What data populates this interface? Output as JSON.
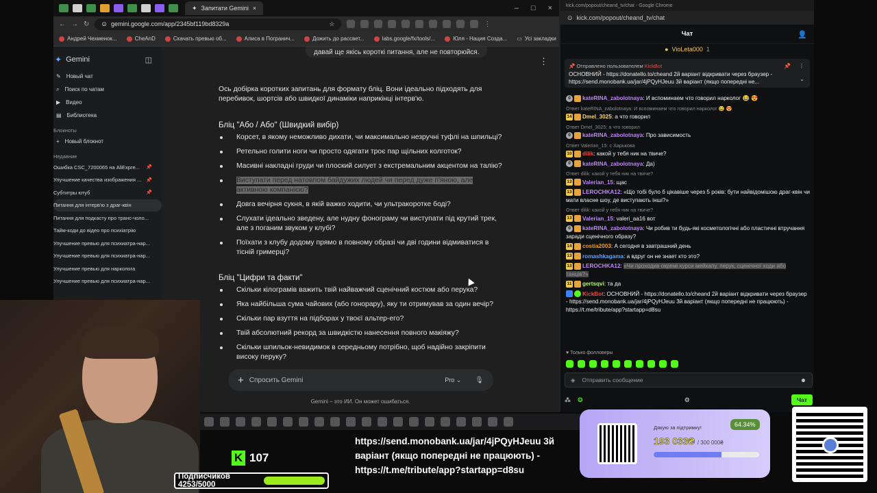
{
  "browser": {
    "active_tab": "Запитати Gemini",
    "url": "gemini.google.com/app/2345bf119bd8329a",
    "bookmarks": [
      "Андрей Чехменок...",
      "CheAnD",
      "Скачать превью об...",
      "Алиса в Погранич...",
      "Дожить до рассвет...",
      "labs.google/fx/tools/...",
      "Юля - Нация Созда...",
      "Усі закладки"
    ]
  },
  "gemini": {
    "logo": "Gemini",
    "nav": [
      "Новый чат",
      "Поиск по чатам",
      "Видео",
      "Библиотека"
    ],
    "notebooks_label": "Блокноты",
    "new_notebook": "Новый блокнот",
    "recent_label": "Недавние",
    "chats": [
      {
        "title": "Ошибка CSC_7200065 на AliExpre...",
        "pinned": true
      },
      {
        "title": "Улучшение качества изображения ...",
        "pinned": true
      },
      {
        "title": "Субтитры ютуб",
        "pinned": true
      },
      {
        "title": "Питання для інтерв'ю з драг-квін",
        "pinned": false
      },
      {
        "title": "Питання для подкасту про транс-чоло...",
        "pinned": false
      },
      {
        "title": "Тайм-коди до відео про психіатрію",
        "pinned": false
      },
      {
        "title": "Улучшение превью для психиатра-нар...",
        "pinned": false
      },
      {
        "title": "Улучшение превью для психиатра-нар...",
        "pinned": false
      },
      {
        "title": "Улучшение превью для нарколога",
        "pinned": false
      },
      {
        "title": "Улучшение превью для психиатра-нар...",
        "pinned": false
      }
    ],
    "prev_user_message": "давай ще якісь короткі питання, але не повторюйся.",
    "intro": "Ось добірка коротких запитань для формату бліц. Вони ідеально підходять для перебивок, шортсів або швидкої динаміки наприкінці інтерв'ю.",
    "section1_title": "Бліц \"Або / Або\" (Швидкий вибір)",
    "section1_items": [
      "Корсет, в якому неможливо дихати, чи максимально незручні туфлі на шпильці?",
      "Ретельно голити ноги чи просто одягати троє пар щільних колготок?",
      "Масивні накладні груди чи плоский силует з екстремальним акцентом на талію?",
      "Виступати перед натовпом байдужих людей чи перед дуже п'яною, але активною компанією?",
      "Довга вечірня сукня, в якій важко ходити, чи ультракоротке боді?",
      "Слухати ідеально зведену, але нудну фонограму чи виступати під крутий трек, але з поганим звуком у клубі?",
      "Поїхати з клубу додому прямо в повному образі чи дві години відмиватися в тісній гримерці?"
    ],
    "section2_title": "Бліц \"Цифри та факти\"",
    "section2_items": [
      "Скільки кілограмів важить твій найважчий сценічний костюм або перука?",
      "Яка найбільша сума чайових (або гонорару), яку ти отримував за один вечір?",
      "Скільки пар взуття на підборах у твоєї альтер-его?",
      "Твій абсолютний рекорд за швидкістю нанесення повного макіяжу?",
      "Скільки шпильок-невидимок в середньому потрібно, щоб надійно закріпити високу перуку?"
    ],
    "input_placeholder": "Спросить Gemini",
    "model": "Pro",
    "disclaimer": "Gemini – это ИИ. Он может ошибаться."
  },
  "kick": {
    "tab_title": "kick.com/popout/cheand_tv/chat - Google Chrome",
    "url": "kick.com/popout/cheand_tv/chat",
    "header": "Чат",
    "gifter": "VioLeta000",
    "gifter_count": "1",
    "pinned_by": "Отправлено пользователем",
    "pinned_user": "KickBot",
    "pinned_text": "ОСНОВНИЙ - https://donatello.to/cheand 2й варіант відкривати через браузер - https://send.monobank.ua/jar/4jPQyHJeuu 3й варіант (якщо попередні не...",
    "messages": [
      {
        "reply": "",
        "badge": "0",
        "user": "kateRINA_zabolotnaya",
        "color": "pink",
        "text": "И вспоминаем что говорил нарколог 😂 😍"
      },
      {
        "reply": "Ответ kateRINA_zabolotnaya: И вспоминаем что говорил нарколог 😂 😍",
        "badge": "14",
        "user": "Dmel_3025",
        "color": "yel",
        "text": "а что говорил"
      },
      {
        "reply": "Ответ Dmel_3025: а что говорил",
        "badge": "0",
        "user": "kateRINA_zabolotnaya",
        "color": "pink",
        "text": "Про зависимость"
      },
      {
        "reply": "Ответ Valerian_15: с Харькова",
        "badge": "10",
        "user": "dilik",
        "color": "red",
        "text": "какой у тебя ник на твиче?"
      },
      {
        "reply": "",
        "badge": "0",
        "user": "kateRINA_zabolotnaya",
        "color": "pink",
        "text": "Да)"
      },
      {
        "reply": "Ответ dilik: какой у тебя ник на твиче?",
        "badge": "13",
        "user": "Valerian_15",
        "color": "violet",
        "text": "щас"
      },
      {
        "reply": "",
        "badge": "13",
        "user": "LEROCHKA12",
        "color": "pink",
        "text": "«Що тобі було б цікавіше через 5 років: бути найвідомішою драг-квін чи мати власне шоу, де виступають інші?»"
      },
      {
        "reply": "Ответ dilik: какой у тебя ник на твиче?",
        "badge": "13",
        "user": "Valerian_15",
        "color": "violet",
        "text": "valeri_aa16 вот"
      },
      {
        "reply": "",
        "badge": "0",
        "user": "kateRINA_zabolotnaya",
        "color": "pink",
        "text": "Чи робив ти будь-які косметологічні або пластичні втручання заради сценічного образу?"
      },
      {
        "reply": "",
        "badge": "14",
        "user": "costia2003",
        "color": "ora",
        "text": "А сегодня в завтрашний день"
      },
      {
        "reply": "",
        "badge": "13",
        "user": "romashkagama",
        "color": "blue",
        "text": "а вдруг он не знает кто это?"
      },
      {
        "reply": "",
        "badge": "13",
        "user": "LEROCHKA12",
        "color": "pink",
        "text": "«Чи проходив окремі курси мейкапу, перук, сценічної ходи або танців?»"
      },
      {
        "reply": "",
        "badge": "11",
        "user": "gertsqvi",
        "color": "grn",
        "text": "та да"
      },
      {
        "reply": "",
        "badge": "",
        "user": "KickBot",
        "color": "red",
        "text": "ОСНОВНИЙ - https://donatello.to/cheand 2й варіант відкривати через браузер - https://send.monobank.ua/jar/4jPQyHJeuu 3й варіант (якщо попередні не працюють) - https://t.me/tribute/app?startapp=d8su"
      }
    ],
    "followers_only": "Только фолловеры",
    "send_placeholder": "Отправить сообщение",
    "chat_button": "Чат"
  },
  "overlay": {
    "kick_followers": "107",
    "subs_label": "Подписчиков 4253/5000",
    "subs_progress": 0.85,
    "ticker": "https://send.monobank.ua/jar/4jPQyHJeuu 3й варіант (якщо попередні не працюють) - https://t.me/tribute/app?startapp=d8su",
    "donate_thanks": "Дякую за підтримку!",
    "donate_percent": "64.34%",
    "donate_amount": "193 033₴",
    "donate_goal": "/ 300 000₴",
    "donate_progress": 0.6434
  },
  "colors": {
    "kick_green": "#53fc18",
    "donate_bg": "#b5a6f5"
  }
}
